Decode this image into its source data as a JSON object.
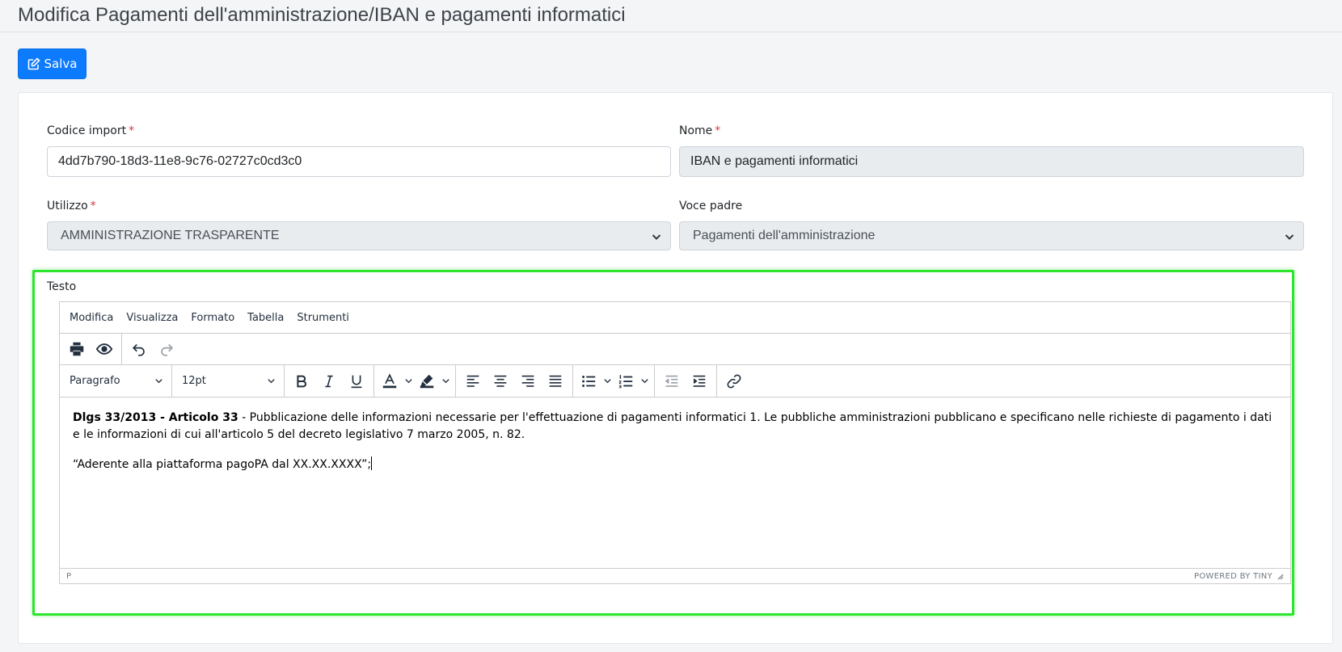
{
  "page": {
    "title": "Modifica Pagamenti dell'amministrazione/IBAN e pagamenti informatici"
  },
  "toolbar": {
    "save_label": "Salva"
  },
  "form": {
    "codice_import": {
      "label": "Codice import",
      "value": "4dd7b790-18d3-11e8-9c76-02727c0cd3c0"
    },
    "nome": {
      "label": "Nome",
      "value": "IBAN e pagamenti informatici"
    },
    "utilizzo": {
      "label": "Utilizzo",
      "value": "AMMINISTRAZIONE TRASPARENTE"
    },
    "voce_padre": {
      "label": "Voce padre",
      "value": "Pagamenti dell'amministrazione"
    },
    "required_mark": "*"
  },
  "editor": {
    "label": "Testo",
    "menu": [
      "Modifica",
      "Visualizza",
      "Formato",
      "Tabella",
      "Strumenti"
    ],
    "block_format": "Paragrafo",
    "font_size": "12pt",
    "content": {
      "p1_bold": "Dlgs 33/2013 - Articolo 33",
      "p1_text": " - Pubblicazione delle informazioni necessarie per l'effettuazione di pagamenti informatici 1. Le pubbliche amministrazioni pubblicano e specificano nelle richieste di pagamento i dati e le informazioni di cui all'articolo 5 del decreto legislativo 7 marzo 2005, n. 82.",
      "p2_text": "“Aderente alla piattaforma pagoPA dal XX.XX.XXXX”;"
    },
    "status_path": "P",
    "branding": "POWERED BY TINY"
  },
  "colors": {
    "primary": "#0d7bfd",
    "highlight_border": "#2ee52e",
    "required": "#dc3545"
  },
  "icons": [
    "edit-icon",
    "print-icon",
    "preview-icon",
    "undo-icon",
    "redo-icon",
    "bold-icon",
    "italic-icon",
    "underline-icon",
    "text-color-icon",
    "highlight-icon",
    "align-left-icon",
    "align-center-icon",
    "align-right-icon",
    "justify-icon",
    "bullet-list-icon",
    "numbered-list-icon",
    "outdent-icon",
    "indent-icon",
    "link-icon",
    "resize-handle-icon"
  ]
}
